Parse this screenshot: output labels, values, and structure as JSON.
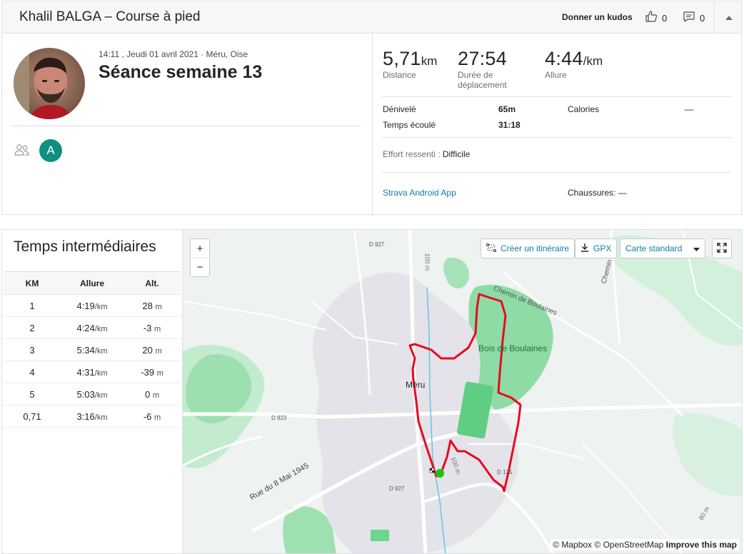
{
  "header": {
    "title": "Khalil BALGA – Course à pied",
    "kudos_link": "Donner un kudos",
    "kudos_count": "0",
    "comment_count": "0"
  },
  "activity": {
    "meta": "14:11 , Jeudi 01 avril 2021 · Méru, Oise",
    "name": "Séance semaine 13",
    "athlete_initial": "A"
  },
  "stats": {
    "distance": {
      "value": "5,71",
      "unit": "km",
      "label": "Distance"
    },
    "moving_time": {
      "value": "27:54",
      "label_line1": "Durée de",
      "label_line2": "déplacement"
    },
    "pace": {
      "value": "4:44",
      "unit": "/km",
      "label": "Allure"
    },
    "elevation": {
      "key": "Dénivelé",
      "value": "65m"
    },
    "elapsed": {
      "key": "Temps écoulé",
      "value": "31:18"
    },
    "calories": {
      "key": "Calories",
      "value": "—"
    },
    "effort": {
      "key": "Effort ressenti :",
      "value": "Difficile"
    },
    "device": "Strava Android App",
    "shoes": "Chaussures: —"
  },
  "splits": {
    "title": "Temps intermédiaires",
    "headers": [
      "KM",
      "Allure",
      "Alt."
    ],
    "pace_unit": "/km",
    "alt_unit": "m",
    "rows": [
      {
        "km": "1",
        "pace": "4:19",
        "alt": "28"
      },
      {
        "km": "2",
        "pace": "4:24",
        "alt": "-3"
      },
      {
        "km": "3",
        "pace": "5:34",
        "alt": "20"
      },
      {
        "km": "4",
        "pace": "4:31",
        "alt": "-39"
      },
      {
        "km": "5",
        "pace": "5:03",
        "alt": "0"
      },
      {
        "km": "0,71",
        "pace": "3:16",
        "alt": "-6"
      }
    ]
  },
  "map": {
    "zoom_in": "+",
    "zoom_out": "−",
    "create_route": "Créer un itinéraire",
    "gpx": "GPX",
    "map_style": "Carte standard",
    "attribution_mapbox": "© Mapbox",
    "attribution_osm": "© OpenStreetMap",
    "attribution_improve": "Improve this map",
    "labels": {
      "town": "Méru",
      "wood": "Bois de Boulaines",
      "chemin_boulaines": "Chemin de Boulaines",
      "chemin_des": "Chemin des",
      "rue_8_mai": "Rue du 8 Mai 1945",
      "d927_top": "D 927",
      "d927_bottom": "D 927",
      "d923": "D 923",
      "d125": "D 125",
      "contour_100_top": "100 m",
      "contour_100_mid": "100 m",
      "contour_80": "80 m"
    },
    "route_color": "#e8091e",
    "start_marker_color": "#16c60c"
  }
}
